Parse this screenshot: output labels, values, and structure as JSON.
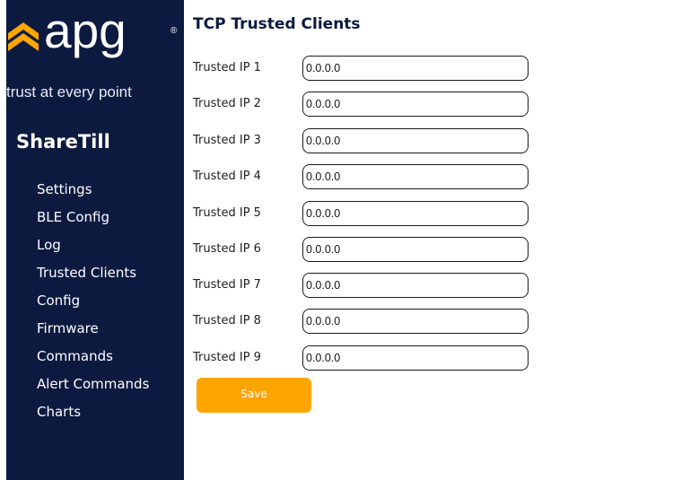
{
  "brand": {
    "logo_text": "apg",
    "logo_reg": "®",
    "tagline": "trust at every point",
    "app_name": "ShareTill",
    "logo_color": "#ffa500"
  },
  "sidebar": {
    "background": "#0c1a40",
    "items": [
      {
        "label": "Settings"
      },
      {
        "label": "BLE Config"
      },
      {
        "label": "Log"
      },
      {
        "label": "Trusted Clients"
      },
      {
        "label": "Config"
      },
      {
        "label": "Firmware"
      },
      {
        "label": "Commands"
      },
      {
        "label": "Alert Commands"
      },
      {
        "label": "Charts"
      }
    ]
  },
  "main": {
    "title": "TCP Trusted Clients",
    "fields": [
      {
        "label": "Trusted IP 1",
        "value": "0.0.0.0"
      },
      {
        "label": "Trusted IP 2",
        "value": "0.0.0.0"
      },
      {
        "label": "Trusted IP 3",
        "value": "0.0.0.0"
      },
      {
        "label": "Trusted IP 4",
        "value": "0.0.0.0"
      },
      {
        "label": "Trusted IP 5",
        "value": "0.0.0.0"
      },
      {
        "label": "Trusted IP 6",
        "value": "0.0.0.0"
      },
      {
        "label": "Trusted IP 7",
        "value": "0.0.0.0"
      },
      {
        "label": "Trusted IP 8",
        "value": "0.0.0.0"
      },
      {
        "label": "Trusted IP 9",
        "value": "0.0.0.0"
      }
    ],
    "save_label": "Save",
    "save_color": "#ffa500"
  }
}
